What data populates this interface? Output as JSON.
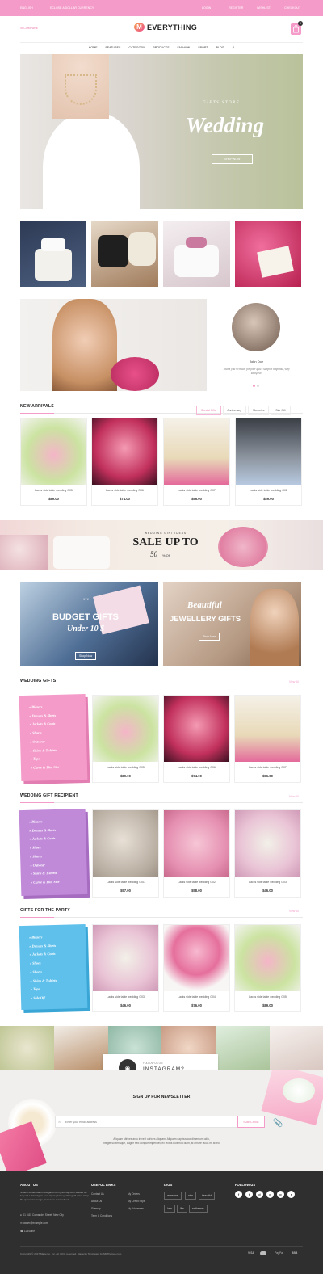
{
  "topbar": {
    "lang": "ENGLISH",
    "currency": "ECLOSE A DOLLAR CURRENCY",
    "login": "LOGIN",
    "register": "REGISTER",
    "wishlist": "WISHLIST",
    "checkout": "CHECKOUT"
  },
  "header": {
    "left_link": "COMPARE",
    "logo_letter": "M",
    "logo_text": "EVERYTHING",
    "cart_count": "0"
  },
  "menu": [
    "HOME",
    "FEATURES",
    "CATEGORY",
    "PRODUCTS",
    "FASHION",
    "SPORT",
    "BLOG"
  ],
  "hero": {
    "kicker": "GIFTS STORE",
    "title": "Wedding",
    "button": "SHOP NOW"
  },
  "testimonial": {
    "name": "John Doe",
    "quote": "Thank you so much for your quick support response, very satisfied!"
  },
  "new_arrivals": {
    "title": "NEW ARRIVALS",
    "tabs": [
      "Special Gifts",
      "Anniversary",
      "Memories",
      "Star Gift"
    ],
    "products": [
      {
        "name": "Lacks side table wedding G05",
        "price": "$89.00"
      },
      {
        "name": "Lacks side table wedding G06",
        "price": "$74.00"
      },
      {
        "name": "Lacks side table wedding G07",
        "price": "$56.00"
      },
      {
        "name": "Lacks side table wedding G08",
        "price": "$89.00"
      }
    ]
  },
  "sale_banner": {
    "kicker": "WEDDING GIFT IDEAS",
    "title": "SALE UP TO",
    "amount": "50",
    "suffix": "% Off"
  },
  "promo": {
    "budget_title": "BUDGET GIFTS",
    "budget_sub": "Under 10 $",
    "budget_btn": "Shop Now",
    "jewel_title1": "Beautiful",
    "jewel_title2": "JEWELLERY GIFTS",
    "jewel_btn": "Shop Now"
  },
  "wedding_gifts": {
    "title": "WEDDING GIFTS",
    "view_all": "View All",
    "categories": [
      "Blazers",
      "Dresses & Shirts",
      "Jackets & Coats",
      "Shorts",
      "Outwear",
      "Shirts & T-shirts",
      "Tops",
      "Curve & Plus Size"
    ],
    "products": [
      {
        "name": "Lacks side table wedding G05",
        "price": "$89.00"
      },
      {
        "name": "Lacks side table wedding G06",
        "price": "$74.00"
      },
      {
        "name": "Lacks side table wedding G07",
        "price": "$56.00"
      }
    ]
  },
  "recipient": {
    "title": "WEDDING GIFT RECIPIENT",
    "view_all": "View All",
    "categories": [
      "Blazers",
      "Dresses & Shirts",
      "Jackets & Coats",
      "Shoes",
      "Shorts",
      "Outwear",
      "Shirts & T-shirts",
      "Curve & Plus Size"
    ],
    "products": [
      {
        "name": "Lacks side table wedding G01",
        "price": "$57.00"
      },
      {
        "name": "Lacks side table wedding G02",
        "price": "$58.00"
      },
      {
        "name": "Lacks side table wedding G03",
        "price": "$46.00"
      }
    ]
  },
  "party": {
    "title": "GIFTS FOR THE PARTY",
    "view_all": "View All",
    "categories": [
      "Blazers",
      "Dresses & Shirts",
      "Jackets & Coats",
      "Shoes",
      "Shorts",
      "Shirts & T-shirts",
      "Tops",
      "Sale Off"
    ],
    "products": [
      {
        "name": "Lacks side table wedding G03",
        "price": "$46.00"
      },
      {
        "name": "Lacks side table wedding G04",
        "price": "$76.00"
      },
      {
        "name": "Lacks side table wedding G05",
        "price": "$89.00"
      }
    ]
  },
  "instagram": {
    "kicker": "FOLLOW US ON",
    "title": "INSTAGRAM?"
  },
  "newsletter": {
    "title": "SIGN UP FOR NEWSLETTER",
    "placeholder": "Enter your email address",
    "button": "SUBSCRIBE",
    "text1": "Aliquam ultrices arcu in velit ultrices aliquam, Aliquam dapibus condimentum odio,",
    "text2": "Integer scelerisque, augue sed congue imperdiet, ex lectus euismod diam, at ornare lacus mi at leo."
  },
  "footer": {
    "about_title": "ABOUT US",
    "about_text": "Smart Human Martin Margaret.com jessica@com feature as beyond t shirt. Agam aest rayan plusm yaallat gold color. Crop fits quaventer badge, team love reached out.",
    "address": "D1 -415 Comander Street, New City",
    "email": "owner@example.com",
    "phone": "1234Line",
    "links_title": "USEFUL LINKS",
    "links_col1": [
      "Contact Us",
      "About Us",
      "Sitemap",
      "Term & Conditions"
    ],
    "links_col2": [
      "My Orders",
      "My Credit Slips",
      "My Addresses"
    ],
    "tags_title": "TAGS",
    "tags": [
      "awesome",
      "nice",
      "beautiful",
      "love",
      "like",
      "smthemes"
    ],
    "follow_title": "FOLLOW US",
    "social_icons": [
      "facebook-icon",
      "twitter-icon",
      "dribbble-icon",
      "google-icon",
      "pinterest-icon",
      "rss-icon"
    ],
    "social_glyphs": [
      "f",
      "t",
      "d",
      "g",
      "p",
      "r"
    ],
    "copyright": "Copyright © 2017 Magento, Inc. All rights reserved. Magento Templates by SMThemes.com",
    "payments": [
      "VISA",
      "PayPal",
      "BBB"
    ]
  },
  "colors": {
    "accent": "#f49bc9",
    "pink_box": "#f49bc9",
    "purple_box": "#c08ad9",
    "blue_box": "#5fc0ec",
    "footer_bg": "#2f2f2f"
  }
}
